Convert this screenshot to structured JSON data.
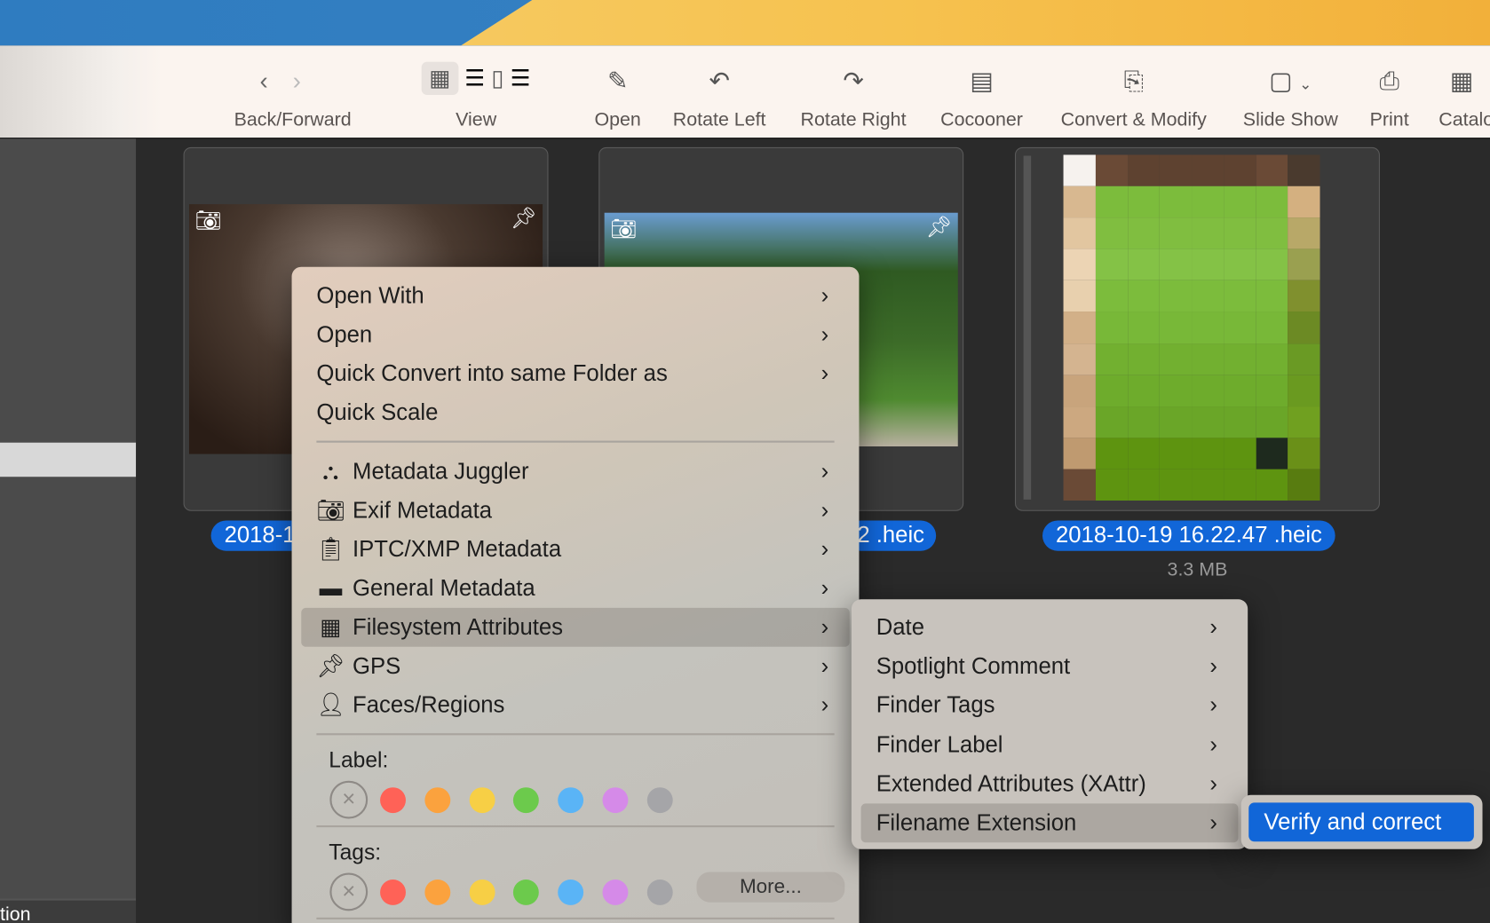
{
  "toolbar": {
    "items": [
      {
        "label": "Back/Forward",
        "icon": "chevron-left-right-icon"
      },
      {
        "label": "View",
        "icon": "view-mode-icons"
      },
      {
        "label": "Open",
        "icon": "open-icon"
      },
      {
        "label": "Rotate Left",
        "icon": "rotate-left-icon"
      },
      {
        "label": "Rotate Right",
        "icon": "rotate-right-icon"
      },
      {
        "label": "Cocooner",
        "icon": "cocooner-icon"
      },
      {
        "label": "Convert & Modify",
        "icon": "convert-icon"
      },
      {
        "label": "Slide Show",
        "icon": "slideshow-icon"
      },
      {
        "label": "Print",
        "icon": "print-icon"
      },
      {
        "label": "Catalo",
        "icon": "catalog-icon"
      }
    ]
  },
  "sidebar": {
    "bottom_label": "tion"
  },
  "files": [
    {
      "name": "2018-1",
      "size": ""
    },
    {
      "name": "2 .heic",
      "size": ""
    },
    {
      "name": "2018-10-19 16.22.47 .heic",
      "size": "3.3 MB"
    }
  ],
  "context_menu": {
    "items": [
      {
        "label": "Open With",
        "submenu": true
      },
      {
        "label": "Open",
        "submenu": true
      },
      {
        "label": "Quick Convert into same Folder as",
        "submenu": true
      },
      {
        "label": "Quick Scale",
        "submenu": false
      },
      {
        "label": "Metadata Juggler",
        "icon": "juggler-icon",
        "submenu": true
      },
      {
        "label": "Exif Metadata",
        "icon": "camera-icon",
        "submenu": true
      },
      {
        "label": "IPTC/XMP Metadata",
        "icon": "clipboard-icon",
        "submenu": true
      },
      {
        "label": "General Metadata",
        "icon": "box-icon",
        "submenu": true
      },
      {
        "label": "Filesystem Attributes",
        "icon": "calendar-icon",
        "submenu": true,
        "selected": true
      },
      {
        "label": "GPS",
        "icon": "pin-icon",
        "submenu": true
      },
      {
        "label": "Faces/Regions",
        "icon": "person-icon",
        "submenu": true
      }
    ],
    "label_heading": "Label:",
    "tags_heading": "Tags:",
    "more_button": "More...",
    "colors": [
      "#ff6257",
      "#fba23e",
      "#f7cf45",
      "#6cca4c",
      "#5ab4f6",
      "#d58ae8",
      "#a5a5a8"
    ]
  },
  "submenu": {
    "items": [
      {
        "label": "Date"
      },
      {
        "label": "Spotlight Comment"
      },
      {
        "label": "Finder Tags"
      },
      {
        "label": "Finder Label"
      },
      {
        "label": "Extended Attributes (XAttr)"
      },
      {
        "label": "Filename Extension",
        "selected": true
      }
    ]
  },
  "submenu2": {
    "items": [
      {
        "label": "Verify and correct",
        "selected": true
      }
    ]
  },
  "accent": "#1166d8"
}
